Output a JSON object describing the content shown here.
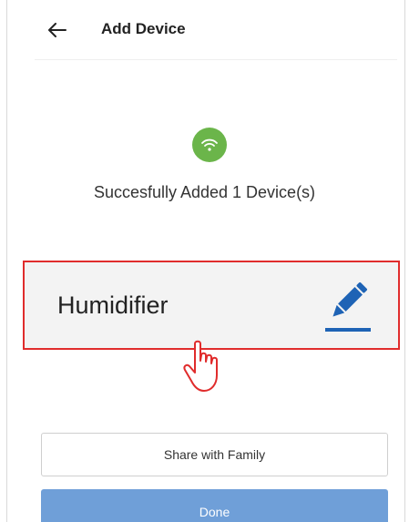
{
  "header": {
    "back_icon": "arrow-left-icon",
    "title": "Add Device"
  },
  "status": {
    "icon": "wifi-icon",
    "icon_color": "#6bb54a",
    "message": "Succesfully Added 1 Device(s)"
  },
  "device": {
    "name": "Humidifier",
    "edit_icon": "pencil-icon",
    "highlight_color": "#e02c2c",
    "accent_color": "#1e63b5"
  },
  "cursor": {
    "icon": "hand-pointer-icon"
  },
  "actions": {
    "share_label": "Share with Family",
    "done_label": "Done",
    "done_color": "#6f9fd8"
  }
}
